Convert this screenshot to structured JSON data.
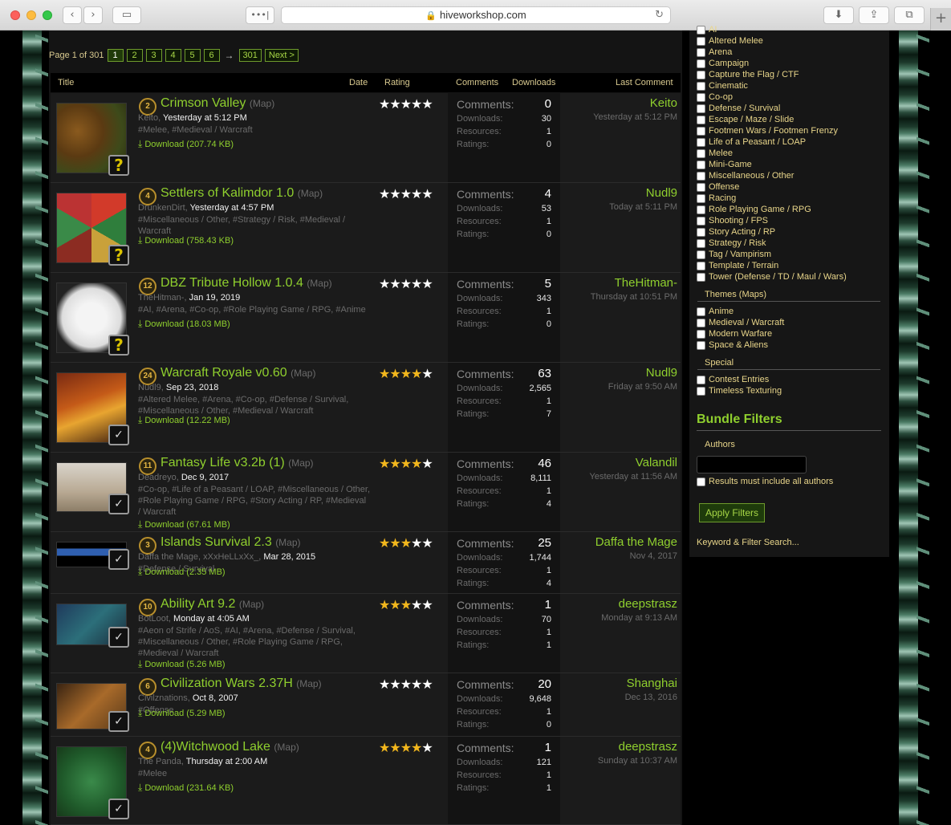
{
  "browser": {
    "url": "hiveworkshop.com",
    "more": "•••|"
  },
  "pager": {
    "label": "Page 1 of 301",
    "pages": [
      "1",
      "2",
      "3",
      "4",
      "5",
      "6"
    ],
    "arrow": "→",
    "last": "301",
    "next": "Next >"
  },
  "headers": {
    "title": "Title",
    "date": "Date",
    "rating": "Rating",
    "comments": "Comments",
    "downloads": "Downloads",
    "last_comment": "Last Comment"
  },
  "labels": {
    "comments": "Comments:",
    "downloads": "Downloads:",
    "resources": "Resources:",
    "ratings": "Ratings:",
    "map": "(Map)"
  },
  "rows": [
    {
      "level": "2",
      "title": "Crimson Valley",
      "author": "Keito,",
      "date": "Yesterday at 5:12 PM",
      "tags": "#Melee, #Medieval / Warcraft",
      "download": "Download (207.74 KB)",
      "rating": 0,
      "comments": "0",
      "downloads": "30",
      "resources": "1",
      "ratings": "0",
      "last_user": "Keito",
      "last_time": "Yesterday at 5:12 PM",
      "badge": "?"
    },
    {
      "level": "4",
      "title": "Settlers of Kalimdor 1.0",
      "author": "DrunkenDirt,",
      "date": "Yesterday at 4:57 PM",
      "tags": "#Miscellaneous / Other, #Strategy / Risk, #Medieval / Warcraft",
      "download": "Download (758.43 KB)",
      "rating": 0,
      "comments": "4",
      "downloads": "53",
      "resources": "1",
      "ratings": "0",
      "last_user": "Nudl9",
      "last_time": "Today at 5:11 PM",
      "badge": "?"
    },
    {
      "level": "12",
      "title": "DBZ Tribute Hollow 1.0.4",
      "author": "TheHitman-,",
      "date": "Jan 19, 2019",
      "tags": "#AI, #Arena, #Co-op, #Role Playing Game / RPG, #Anime",
      "download": "Download (18.03 MB)",
      "rating": 0,
      "comments": "5",
      "downloads": "343",
      "resources": "1",
      "ratings": "0",
      "last_user": "TheHitman-",
      "last_time": "Thursday at 10:51 PM",
      "badge": "?"
    },
    {
      "level": "24",
      "title": "Warcraft Royale v0.60",
      "author": "Nudl9,",
      "date": "Sep 23, 2018",
      "tags": "#Altered Melee, #Arena, #Co-op, #Defense / Survival, #Miscellaneous / Other, #Medieval / Warcraft",
      "download": "Download (12.22 MB)",
      "rating": 4,
      "comments": "63",
      "downloads": "2,565",
      "resources": "1",
      "ratings": "7",
      "last_user": "Nudl9",
      "last_time": "Friday at 9:50 AM",
      "badge": "✓"
    },
    {
      "level": "11",
      "title": "Fantasy Life v3.2b (1)",
      "author": "Deadreyo,",
      "date": "Dec 9, 2017",
      "tags": "#Co-op, #Life of a Peasant / LOAP, #Miscellaneous / Other, #Role Playing Game / RPG, #Story Acting / RP, #Medieval / Warcraft",
      "download": "Download (67.61 MB)",
      "rating": 4,
      "comments": "46",
      "downloads": "8,111",
      "resources": "1",
      "ratings": "4",
      "last_user": "Valandil",
      "last_time": "Yesterday at 11:56 AM",
      "badge": "✓"
    },
    {
      "level": "3",
      "title": "Islands Survival 2.3",
      "author": "Daffa the Mage, xXxHeLLxXx_,",
      "date": "Mar 28, 2015",
      "tags": "#Defense / Survival",
      "download": "Download (2.35 MB)",
      "rating": 3,
      "comments": "25",
      "downloads": "1,744",
      "resources": "1",
      "ratings": "4",
      "last_user": "Daffa the Mage",
      "last_time": "Nov 4, 2017",
      "badge": "✓"
    },
    {
      "level": "10",
      "title": "Ability Art 9.2",
      "author": "BotLoot,",
      "date": "Monday at 4:05 AM",
      "tags": "#Aeon of Strife / AoS, #AI, #Arena, #Defense / Survival, #Miscellaneous / Other, #Role Playing Game / RPG, #Medieval / Warcraft",
      "download": "Download (5.26 MB)",
      "rating": 3,
      "comments": "1",
      "downloads": "70",
      "resources": "1",
      "ratings": "1",
      "last_user": "deepstrasz",
      "last_time": "Monday at 9:13 AM",
      "badge": "✓"
    },
    {
      "level": "6",
      "title": "Civilization Wars 2.37H",
      "author": "Civilznations,",
      "date": "Oct 8, 2007",
      "tags": "#Offense",
      "download": "Download (5.29 MB)",
      "rating": 0,
      "comments": "20",
      "downloads": "9,648",
      "resources": "1",
      "ratings": "0",
      "last_user": "Shanghai",
      "last_time": "Dec 13, 2016",
      "badge": "✓"
    },
    {
      "level": "4",
      "title": "(4)Witchwood Lake",
      "author": "The Panda,",
      "date": "Thursday at 2:00 AM",
      "tags": "#Melee",
      "download": "Download (231.64 KB)",
      "rating": 4,
      "comments": "1",
      "downloads": "121",
      "resources": "1",
      "ratings": "1",
      "last_user": "deepstrasz",
      "last_time": "Sunday at 10:37 AM",
      "badge": "✓"
    }
  ],
  "sidebar": {
    "genres": [
      "AI",
      "Altered Melee",
      "Arena",
      "Campaign",
      "Capture the Flag / CTF",
      "Cinematic",
      "Co-op",
      "Defense / Survival",
      "Escape / Maze / Slide",
      "Footmen Wars / Footmen Frenzy",
      "Life of a Peasant / LOAP",
      "Melee",
      "Mini-Game",
      "Miscellaneous / Other",
      "Offense",
      "Racing",
      "Role Playing Game / RPG",
      "Shooting / FPS",
      "Story Acting / RP",
      "Strategy / Risk",
      "Tag / Vampirism",
      "Template / Terrain",
      "Tower (Defense / TD / Maul / Wars)"
    ],
    "themes_title": "Themes (Maps)",
    "themes": [
      "Anime",
      "Medieval / Warcraft",
      "Modern Warfare",
      "Space & Aliens"
    ],
    "special_title": "Special",
    "special": [
      "Contest Entries",
      "Timeless Texturing"
    ],
    "bundle_title": "Bundle Filters",
    "authors_title": "Authors",
    "authors_value": "",
    "authors_check": "Results must include all authors",
    "apply": "Apply Filters",
    "keyword": "Keyword & Filter Search..."
  }
}
